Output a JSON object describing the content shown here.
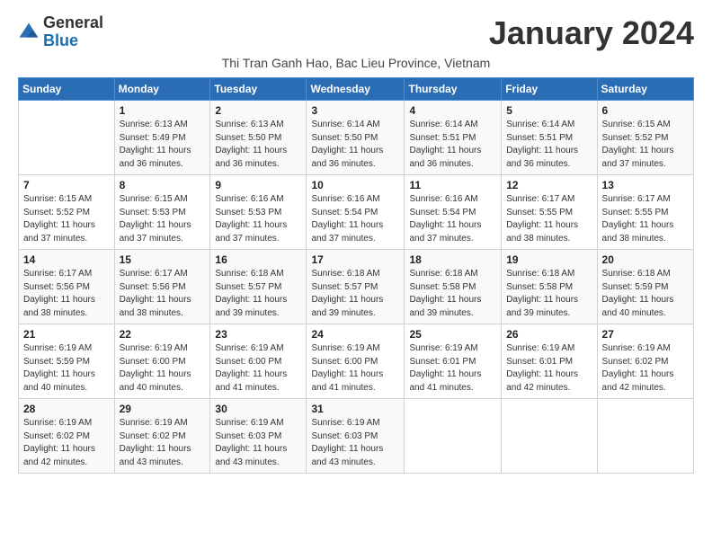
{
  "logo": {
    "general": "General",
    "blue": "Blue"
  },
  "title": "January 2024",
  "subtitle": "Thi Tran Ganh Hao, Bac Lieu Province, Vietnam",
  "days_of_week": [
    "Sunday",
    "Monday",
    "Tuesday",
    "Wednesday",
    "Thursday",
    "Friday",
    "Saturday"
  ],
  "weeks": [
    [
      {
        "day": "",
        "info": ""
      },
      {
        "day": "1",
        "info": "Sunrise: 6:13 AM\nSunset: 5:49 PM\nDaylight: 11 hours and 36 minutes."
      },
      {
        "day": "2",
        "info": "Sunrise: 6:13 AM\nSunset: 5:50 PM\nDaylight: 11 hours and 36 minutes."
      },
      {
        "day": "3",
        "info": "Sunrise: 6:14 AM\nSunset: 5:50 PM\nDaylight: 11 hours and 36 minutes."
      },
      {
        "day": "4",
        "info": "Sunrise: 6:14 AM\nSunset: 5:51 PM\nDaylight: 11 hours and 36 minutes."
      },
      {
        "day": "5",
        "info": "Sunrise: 6:14 AM\nSunset: 5:51 PM\nDaylight: 11 hours and 36 minutes."
      },
      {
        "day": "6",
        "info": "Sunrise: 6:15 AM\nSunset: 5:52 PM\nDaylight: 11 hours and 37 minutes."
      }
    ],
    [
      {
        "day": "7",
        "info": "Sunrise: 6:15 AM\nSunset: 5:52 PM\nDaylight: 11 hours and 37 minutes."
      },
      {
        "day": "8",
        "info": "Sunrise: 6:15 AM\nSunset: 5:53 PM\nDaylight: 11 hours and 37 minutes."
      },
      {
        "day": "9",
        "info": "Sunrise: 6:16 AM\nSunset: 5:53 PM\nDaylight: 11 hours and 37 minutes."
      },
      {
        "day": "10",
        "info": "Sunrise: 6:16 AM\nSunset: 5:54 PM\nDaylight: 11 hours and 37 minutes."
      },
      {
        "day": "11",
        "info": "Sunrise: 6:16 AM\nSunset: 5:54 PM\nDaylight: 11 hours and 37 minutes."
      },
      {
        "day": "12",
        "info": "Sunrise: 6:17 AM\nSunset: 5:55 PM\nDaylight: 11 hours and 38 minutes."
      },
      {
        "day": "13",
        "info": "Sunrise: 6:17 AM\nSunset: 5:55 PM\nDaylight: 11 hours and 38 minutes."
      }
    ],
    [
      {
        "day": "14",
        "info": "Sunrise: 6:17 AM\nSunset: 5:56 PM\nDaylight: 11 hours and 38 minutes."
      },
      {
        "day": "15",
        "info": "Sunrise: 6:17 AM\nSunset: 5:56 PM\nDaylight: 11 hours and 38 minutes."
      },
      {
        "day": "16",
        "info": "Sunrise: 6:18 AM\nSunset: 5:57 PM\nDaylight: 11 hours and 39 minutes."
      },
      {
        "day": "17",
        "info": "Sunrise: 6:18 AM\nSunset: 5:57 PM\nDaylight: 11 hours and 39 minutes."
      },
      {
        "day": "18",
        "info": "Sunrise: 6:18 AM\nSunset: 5:58 PM\nDaylight: 11 hours and 39 minutes."
      },
      {
        "day": "19",
        "info": "Sunrise: 6:18 AM\nSunset: 5:58 PM\nDaylight: 11 hours and 39 minutes."
      },
      {
        "day": "20",
        "info": "Sunrise: 6:18 AM\nSunset: 5:59 PM\nDaylight: 11 hours and 40 minutes."
      }
    ],
    [
      {
        "day": "21",
        "info": "Sunrise: 6:19 AM\nSunset: 5:59 PM\nDaylight: 11 hours and 40 minutes."
      },
      {
        "day": "22",
        "info": "Sunrise: 6:19 AM\nSunset: 6:00 PM\nDaylight: 11 hours and 40 minutes."
      },
      {
        "day": "23",
        "info": "Sunrise: 6:19 AM\nSunset: 6:00 PM\nDaylight: 11 hours and 41 minutes."
      },
      {
        "day": "24",
        "info": "Sunrise: 6:19 AM\nSunset: 6:00 PM\nDaylight: 11 hours and 41 minutes."
      },
      {
        "day": "25",
        "info": "Sunrise: 6:19 AM\nSunset: 6:01 PM\nDaylight: 11 hours and 41 minutes."
      },
      {
        "day": "26",
        "info": "Sunrise: 6:19 AM\nSunset: 6:01 PM\nDaylight: 11 hours and 42 minutes."
      },
      {
        "day": "27",
        "info": "Sunrise: 6:19 AM\nSunset: 6:02 PM\nDaylight: 11 hours and 42 minutes."
      }
    ],
    [
      {
        "day": "28",
        "info": "Sunrise: 6:19 AM\nSunset: 6:02 PM\nDaylight: 11 hours and 42 minutes."
      },
      {
        "day": "29",
        "info": "Sunrise: 6:19 AM\nSunset: 6:02 PM\nDaylight: 11 hours and 43 minutes."
      },
      {
        "day": "30",
        "info": "Sunrise: 6:19 AM\nSunset: 6:03 PM\nDaylight: 11 hours and 43 minutes."
      },
      {
        "day": "31",
        "info": "Sunrise: 6:19 AM\nSunset: 6:03 PM\nDaylight: 11 hours and 43 minutes."
      },
      {
        "day": "",
        "info": ""
      },
      {
        "day": "",
        "info": ""
      },
      {
        "day": "",
        "info": ""
      }
    ]
  ]
}
